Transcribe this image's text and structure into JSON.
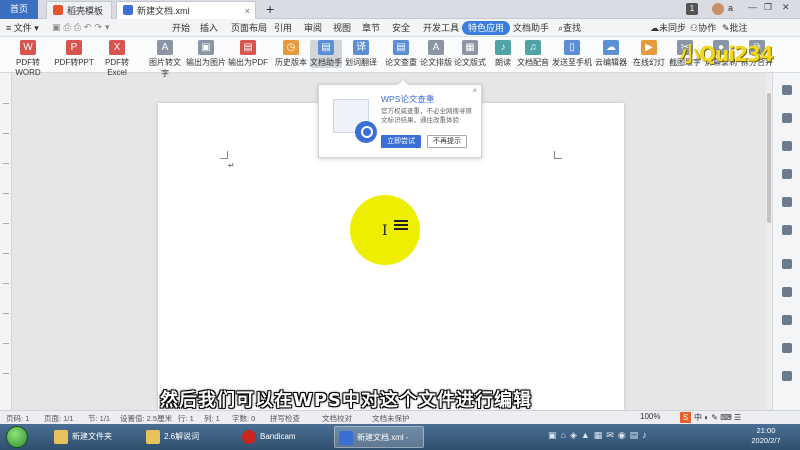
{
  "tabs": {
    "home": "首页",
    "template": "稻壳模板",
    "doc": "新建文档.xml",
    "add": "+"
  },
  "titlebar": {
    "badge": "1",
    "user": "a"
  },
  "menu": {
    "file": "文件",
    "items": [
      "开始",
      "插入",
      "页面布局",
      "引用",
      "审阅",
      "视图",
      "章节",
      "安全",
      "开发工具",
      "特色应用",
      "文档助手",
      "查找"
    ],
    "active_item": "特色应用",
    "sync": "未同步",
    "collab": "协作",
    "share": "批注"
  },
  "ribbon": {
    "buttons": [
      "PDF转WORD",
      "PDF转PPT",
      "PDF转Excel",
      "图片转文字",
      "输出为图片",
      "输出为PDF",
      "历史版本",
      "文档助手",
      "划词翻译",
      "论文查重",
      "论文排版",
      "论文版式",
      "朗读",
      "文档配音",
      "发送至手机",
      "云编辑器",
      "在线幻灯",
      "截图取字",
      "屏幕录制",
      "拆分合并"
    ]
  },
  "popup": {
    "title": "WPS论文查重",
    "description": "官方权威查重，不必全网搜寻原文标识结果，通往改重体验",
    "primary": "立即尝试",
    "secondary": "不再提示",
    "close": "×"
  },
  "subtitle": "然后我们可以在WPS中对这个文件进行编辑",
  "watermark": "小Qui234",
  "status": {
    "page": "页码: 1",
    "pages": "页面: 1/1",
    "section": "节: 1/1",
    "setting": "设置值: 2.5厘米",
    "row": "行: 1",
    "col": "列: 1",
    "words": "字数: 0",
    "spell": "拼写检查",
    "proof": "文档校对",
    "protect": "文档未保护",
    "zoom": "100%"
  },
  "ime": {
    "logo": "S",
    "mode": "中"
  },
  "taskbar": {
    "items": [
      "新建文件夹",
      "2.6解说词",
      "Bandicam",
      "新建文档.xml - WPS..."
    ],
    "time": "21:00",
    "date": "2020/2/7"
  },
  "colors": {
    "accent": "#3b6fbf",
    "spotlight": "#eeee00",
    "menu_active": "#3b7ddd"
  }
}
